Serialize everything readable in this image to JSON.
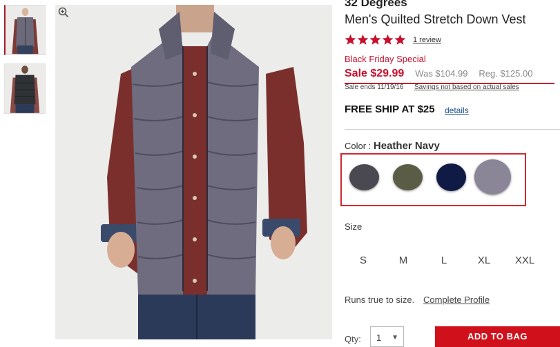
{
  "product": {
    "brand": "32 Degrees",
    "title": "Men's Quilted Stretch Down Vest",
    "rating_stars": 5,
    "review_link": "1 review",
    "promo": "Black Friday Special",
    "sale_price": "Sale $29.99",
    "was_price": "Was $104.99",
    "reg_price": "Reg. $125.00",
    "sale_ends": "Sale ends 11/19/16",
    "savings_link": "Savings not based on actual sales"
  },
  "shipping": {
    "free_ship": "FREE SHIP AT $25",
    "details_link": "details"
  },
  "color": {
    "label": "Color : ",
    "selected": "Heather Navy",
    "swatches": [
      {
        "name": "charcoal",
        "color": "#4a4850"
      },
      {
        "name": "olive",
        "color": "#5a5c45"
      },
      {
        "name": "navy",
        "color": "#0f1a45"
      },
      {
        "name": "heather-navy",
        "color": "#8a8698"
      }
    ]
  },
  "size": {
    "label": "Size",
    "options": [
      "S",
      "M",
      "L",
      "XL",
      "XXL"
    ]
  },
  "fit": {
    "runs_true": "Runs true to size.",
    "complete_profile": "Complete Profile"
  },
  "purchase": {
    "qty_label": "Qty:",
    "qty_value": "1",
    "add_to_bag": "ADD TO BAG"
  },
  "icons": {
    "zoom": "zoom-in-icon",
    "star": "star-icon",
    "chevron": "chevron-down-icon"
  },
  "colors": {
    "accent_red": "#c8102e",
    "button_red": "#d0111b",
    "link_blue": "#1a4d8f"
  }
}
